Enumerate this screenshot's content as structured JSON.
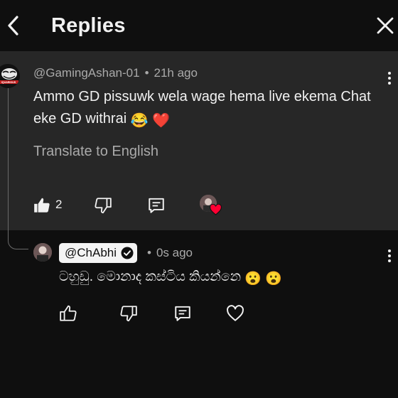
{
  "header": {
    "title": "Replies"
  },
  "parent_comment": {
    "author": "@GamingAshan-01",
    "separator": "•",
    "time": "21h ago",
    "text": "Ammo GD pissuwk wela wage hema live ekema Chat eke GD withrai",
    "emojis": [
      "😂",
      "❤️"
    ],
    "translate_label": "Translate to English",
    "like_count": "2",
    "avatar_text": "IQUARIOUS"
  },
  "reply": {
    "author": "@ChAbhi",
    "verified": true,
    "separator": "•",
    "time": "0s ago",
    "text": "ටහුඩු. මොනාද කස්ටිය කියන්නෙ",
    "emojis": [
      "😮",
      "😮"
    ]
  },
  "icons": {
    "back": "chevron-left-icon",
    "close": "close-icon",
    "more": "vertical-dots-icon",
    "like": "thumbs-up-icon",
    "dislike": "thumbs-down-icon",
    "reply": "comment-icon",
    "creator_heart": "heart-icon",
    "verified": "check-circle-icon"
  },
  "colors": {
    "background": "#0f0f0f",
    "highlight": "#272727",
    "secondary_text": "#aaaaaa",
    "heart": "#ff0033"
  }
}
